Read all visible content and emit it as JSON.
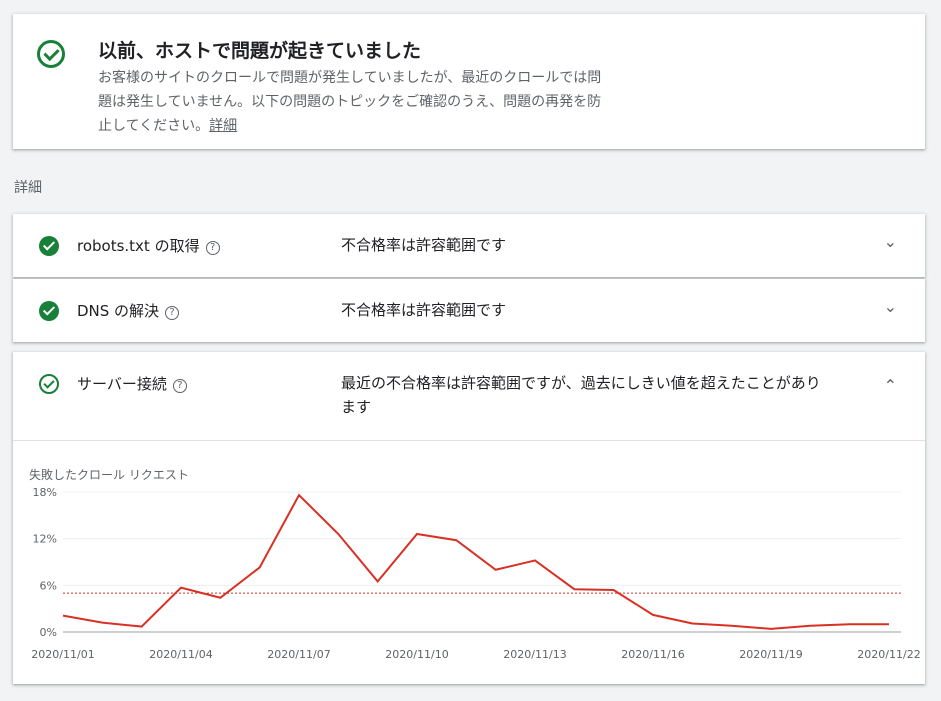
{
  "summary": {
    "title": "以前、ホストで問題が起きていました",
    "desc_line1": "お客様のサイトのクロールで問題が発生していましたが、最近のクロールでは問",
    "desc_line2": "題は発生していません。以下の問題のトピックをご確認のうえ、問題の再発を防",
    "desc_line3": "止してください。",
    "link": "詳細"
  },
  "section_label": "詳細",
  "rows": [
    {
      "name": "robots.txt の取得",
      "status": "不合格率は許容範囲です"
    },
    {
      "name": "DNS の解決",
      "status": "不合格率は許容範囲です"
    },
    {
      "name": "サーバー接続",
      "status_line1": "最近の不合格率は許容範囲ですが、過去にしきい値を超えたことがあり",
      "status_line2": "ます"
    }
  ],
  "help_glyph": "?",
  "chevron_down": "⌄",
  "chevron_up": "⌃",
  "chart_title": "失敗したクロール リクエスト",
  "colors": {
    "accent_green": "#188038",
    "line": "#d93025",
    "threshold": "#d93025"
  },
  "chart_data": {
    "type": "line",
    "title": "失敗したクロール リクエスト",
    "x": [
      "2020/11/01",
      "2020/11/02",
      "2020/11/03",
      "2020/11/04",
      "2020/11/05",
      "2020/11/06",
      "2020/11/07",
      "2020/11/08",
      "2020/11/09",
      "2020/11/10",
      "2020/11/11",
      "2020/11/12",
      "2020/11/13",
      "2020/11/14",
      "2020/11/15",
      "2020/11/16",
      "2020/11/17",
      "2020/11/18",
      "2020/11/19",
      "2020/11/20",
      "2020/11/21",
      "2020/11/22"
    ],
    "series": [
      {
        "values": [
          2.1,
          1.2,
          0.7,
          5.7,
          4.4,
          8.3,
          17.6,
          12.6,
          6.5,
          12.6,
          11.8,
          8.0,
          9.2,
          5.5,
          5.4,
          2.2,
          1.1,
          0.8,
          0.4,
          0.8,
          1.0,
          1.0
        ]
      }
    ],
    "threshold": 5.0,
    "xticks": [
      "2020/11/01",
      "2020/11/04",
      "2020/11/07",
      "2020/11/10",
      "2020/11/13",
      "2020/11/16",
      "2020/11/19",
      "2020/11/22"
    ],
    "yticks": [
      "0%",
      "6%",
      "12%",
      "18%"
    ],
    "ylim": [
      0,
      18
    ],
    "grid": true
  }
}
